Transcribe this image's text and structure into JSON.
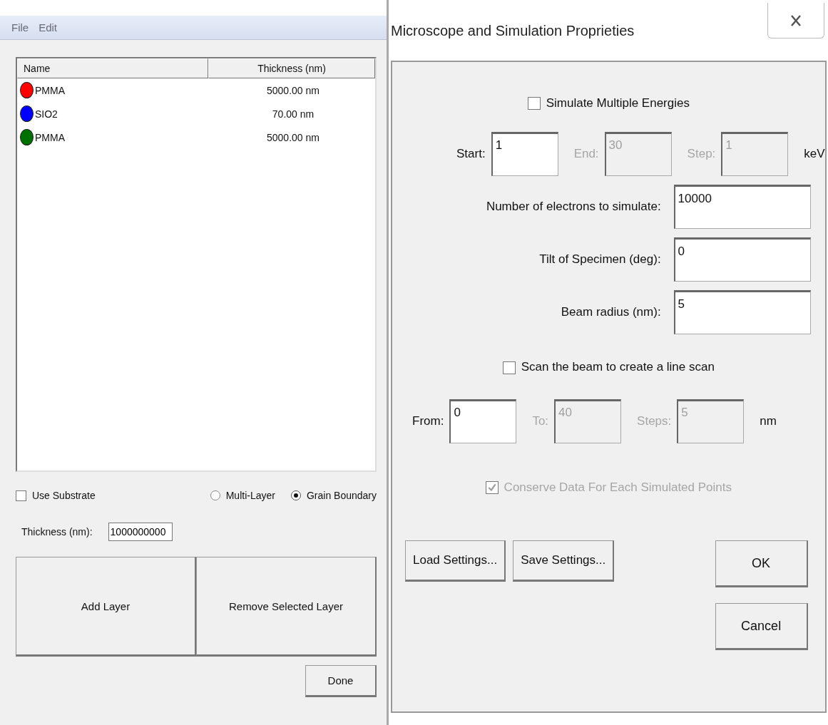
{
  "layer_editor": {
    "menu": [
      {
        "label": "File"
      },
      {
        "label": "Edit"
      }
    ],
    "layers_table": {
      "columns": [
        "Name",
        "Thickness (nm)"
      ],
      "rows": [
        {
          "name": "PMMA",
          "thickness": "5000.00 nm",
          "color": "#ff0000"
        },
        {
          "name": "SIO2",
          "thickness": "70.00 nm",
          "color": "#0000ff"
        },
        {
          "name": "PMMA",
          "thickness": "5000.00 nm",
          "color": "#007000"
        }
      ]
    },
    "use_substrate": {
      "label": "Use Substrate",
      "checked": false
    },
    "layer_mode": [
      {
        "label": "Multi-Layer",
        "selected": false
      },
      {
        "label": "Grain Boundary",
        "selected": true
      }
    ],
    "substrate_thickness": {
      "label": "Thickness (nm):",
      "value": "1000000000"
    },
    "add_button": "Add Layer",
    "remove_button": "Remove Selected Layer",
    "done_button": "Done"
  },
  "dialog": {
    "title": "Microscope and Simulation Proprieties",
    "simulate_multiple_energies": {
      "label": "Simulate Multiple Energies",
      "checked": false
    },
    "energy_fields": [
      {
        "label": "Start:",
        "value": "1",
        "disabled": false
      },
      {
        "label": "End:",
        "value": "30",
        "disabled": true
      },
      {
        "label": "Step:",
        "value": "1",
        "disabled": true
      }
    ],
    "energy_unit": "keV",
    "parameters": [
      {
        "label": "Number of electrons to simulate:",
        "value": "10000"
      },
      {
        "label": "Tilt of Specimen (deg):",
        "value": "0"
      },
      {
        "label": "Beam radius (nm):",
        "value": "5"
      }
    ],
    "line_scan": {
      "label": "Scan the beam to create a line scan",
      "checked": false
    },
    "scan_fields": [
      {
        "label": "From:",
        "value": "0",
        "disabled": false
      },
      {
        "label": "To:",
        "value": "40",
        "disabled": true
      },
      {
        "label": "Steps:",
        "value": "5",
        "disabled": true
      }
    ],
    "scan_unit": "nm",
    "conserve_data": {
      "label": "Conserve Data For Each Simulated Points",
      "checked": true,
      "disabled": true
    },
    "load_button": "Load Settings...",
    "save_button": "Save Settings...",
    "ok_button": "OK",
    "cancel_button": "Cancel"
  }
}
